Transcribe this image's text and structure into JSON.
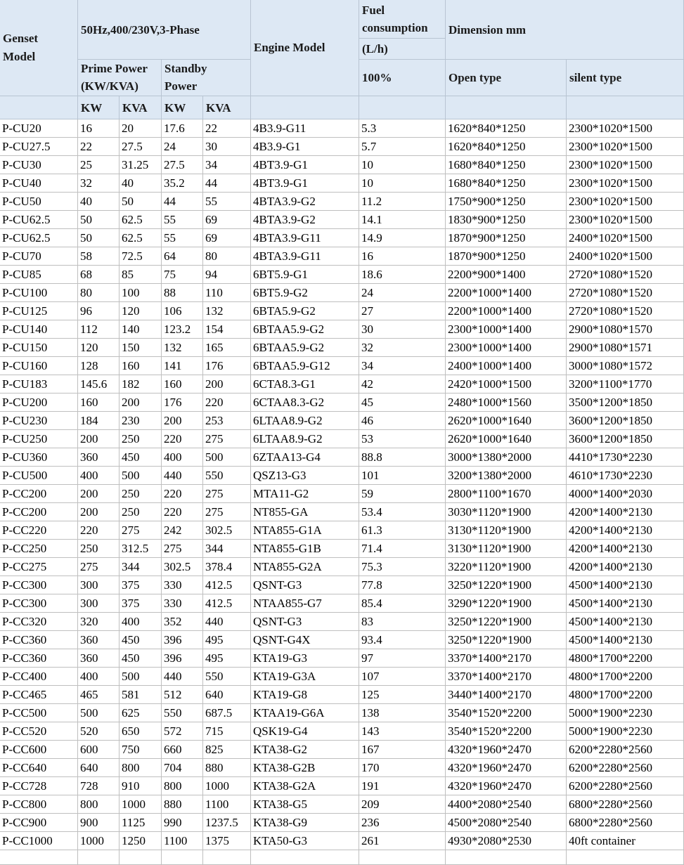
{
  "header": {
    "genset_model": "Genset\nModel",
    "power_spec": "50Hz,400/230V,3-Phase",
    "engine_model": "Engine Model",
    "fuel_consumption": "Fuel\nconsumption",
    "fuel_unit": "(L/h)",
    "dimension": "Dimension mm",
    "prime_power": "Prime Power\n(KW/KVA)",
    "standby_power": "Standby\nPower",
    "fuel_load": "100%",
    "open_type": "Open type",
    "silent_type": "silent type",
    "unit_kw_prime": "KW",
    "unit_kva_prime": "KVA",
    "unit_kw_standby": "KW",
    "unit_kva_standby": "KVA"
  },
  "rows": [
    [
      "P-CU20",
      "16",
      "20",
      "17.6",
      "22",
      "4B3.9-G11",
      "5.3",
      "1620*840*1250",
      "2300*1020*1500"
    ],
    [
      "P-CU27.5",
      "22",
      "27.5",
      "24",
      "30",
      "4B3.9-G1",
      "5.7",
      "1620*840*1250",
      "2300*1020*1500"
    ],
    [
      "P-CU30",
      "25",
      "31.25",
      "27.5",
      "34",
      "4BT3.9-G1",
      "10",
      "1680*840*1250",
      "2300*1020*1500"
    ],
    [
      "P-CU40",
      "32",
      "40",
      "35.2",
      "44",
      "4BT3.9-G1",
      "10",
      "1680*840*1250",
      "2300*1020*1500"
    ],
    [
      "P-CU50",
      "40",
      "50",
      "44",
      "55",
      "4BTA3.9-G2",
      "11.2",
      "1750*900*1250",
      "2300*1020*1500"
    ],
    [
      "P-CU62.5",
      "50",
      "62.5",
      "55",
      "69",
      "4BTA3.9-G2",
      "14.1",
      "1830*900*1250",
      "2300*1020*1500"
    ],
    [
      "P-CU62.5",
      "50",
      "62.5",
      "55",
      "69",
      "4BTA3.9-G11",
      "14.9",
      "1870*900*1250",
      "2400*1020*1500"
    ],
    [
      "P-CU70",
      "58",
      "72.5",
      "64",
      "80",
      "4BTA3.9-G11",
      "16",
      "1870*900*1250",
      "2400*1020*1500"
    ],
    [
      "P-CU85",
      "68",
      "85",
      "75",
      "94",
      "6BT5.9-G1",
      "18.6",
      "2200*900*1400",
      "2720*1080*1520"
    ],
    [
      "P-CU100",
      "80",
      "100",
      "88",
      "110",
      "6BT5.9-G2",
      "24",
      "2200*1000*1400",
      "2720*1080*1520"
    ],
    [
      "P-CU125",
      "96",
      "120",
      "106",
      "132",
      "6BTA5.9-G2",
      "27",
      "2200*1000*1400",
      "2720*1080*1520"
    ],
    [
      "P-CU140",
      "112",
      "140",
      "123.2",
      "154",
      "6BTAA5.9-G2",
      "30",
      "2300*1000*1400",
      "2900*1080*1570"
    ],
    [
      "P-CU150",
      "120",
      "150",
      "132",
      "165",
      "6BTAA5.9-G2",
      "32",
      "2300*1000*1400",
      "2900*1080*1571"
    ],
    [
      "P-CU160",
      "128",
      "160",
      "141",
      "176",
      "6BTAA5.9-G12",
      "34",
      "2400*1000*1400",
      "3000*1080*1572"
    ],
    [
      "P-CU183",
      "145.6",
      "182",
      "160",
      "200",
      "6CTA8.3-G1",
      "42",
      "2420*1000*1500",
      "3200*1100*1770"
    ],
    [
      "P-CU200",
      "160",
      "200",
      "176",
      "220",
      "6CTAA8.3-G2",
      "45",
      "2480*1000*1560",
      "3500*1200*1850"
    ],
    [
      "P-CU230",
      "184",
      "230",
      "200",
      "253",
      "6LTAA8.9-G2",
      "46",
      "2620*1000*1640",
      "3600*1200*1850"
    ],
    [
      "P-CU250",
      "200",
      "250",
      "220",
      "275",
      "6LTAA8.9-G2",
      "53",
      "2620*1000*1640",
      "3600*1200*1850"
    ],
    [
      "P-CU360",
      "360",
      "450",
      "400",
      "500",
      "6ZTAA13-G4",
      "88.8",
      "3000*1380*2000",
      "4410*1730*2230"
    ],
    [
      "P-CU500",
      "400",
      "500",
      "440",
      "550",
      "QSZ13-G3",
      "101",
      "3200*1380*2000",
      "4610*1730*2230"
    ],
    [
      "P-CC200",
      "200",
      "250",
      "220",
      "275",
      "MTA11-G2",
      "59",
      "2800*1100*1670",
      "4000*1400*2030"
    ],
    [
      "P-CC200",
      "200",
      "250",
      "220",
      "275",
      "NT855-GA",
      "53.4",
      "3030*1120*1900",
      "4200*1400*2130"
    ],
    [
      "P-CC220",
      "220",
      "275",
      "242",
      "302.5",
      "NTA855-G1A",
      "61.3",
      "3130*1120*1900",
      "4200*1400*2130"
    ],
    [
      "P-CC250",
      "250",
      "312.5",
      "275",
      "344",
      "NTA855-G1B",
      "71.4",
      "3130*1120*1900",
      "4200*1400*2130"
    ],
    [
      "P-CC275",
      "275",
      "344",
      "302.5",
      "378.4",
      "NTA855-G2A",
      "75.3",
      "3220*1120*1900",
      "4200*1400*2130"
    ],
    [
      "P-CC300",
      "300",
      "375",
      "330",
      "412.5",
      "QSNT-G3",
      "77.8",
      "3250*1220*1900",
      "4500*1400*2130"
    ],
    [
      "P-CC300",
      "300",
      "375",
      "330",
      "412.5",
      "NTAA855-G7",
      "85.4",
      "3290*1220*1900",
      "4500*1400*2130"
    ],
    [
      "P-CC320",
      "320",
      "400",
      "352",
      "440",
      "QSNT-G3",
      "83",
      "3250*1220*1900",
      "4500*1400*2130"
    ],
    [
      "P-CC360",
      "360",
      "450",
      "396",
      "495",
      "QSNT-G4X",
      "93.4",
      "3250*1220*1900",
      "4500*1400*2130"
    ],
    [
      "P-CC360",
      "360",
      "450",
      "396",
      "495",
      "KTA19-G3",
      "97",
      "3370*1400*2170",
      "4800*1700*2200"
    ],
    [
      "P-CC400",
      "400",
      "500",
      "440",
      "550",
      "KTA19-G3A",
      "107",
      "3370*1400*2170",
      "4800*1700*2200"
    ],
    [
      "P-CC465",
      "465",
      "581",
      "512",
      "640",
      "KTA19-G8",
      "125",
      "3440*1400*2170",
      "4800*1700*2200"
    ],
    [
      "P-CC500",
      "500",
      "625",
      "550",
      "687.5",
      "KTAA19-G6A",
      "138",
      "3540*1520*2200",
      "5000*1900*2230"
    ],
    [
      "P-CC520",
      "520",
      "650",
      "572",
      "715",
      "QSK19-G4",
      "143",
      "3540*1520*2200",
      "5000*1900*2230"
    ],
    [
      "P-CC600",
      "600",
      "750",
      "660",
      "825",
      "KTA38-G2",
      "167",
      "4320*1960*2470",
      "6200*2280*2560"
    ],
    [
      "P-CC640",
      "640",
      "800",
      "704",
      "880",
      "KTA38-G2B",
      "170",
      "4320*1960*2470",
      "6200*2280*2560"
    ],
    [
      "P-CC728",
      "728",
      "910",
      "800",
      "1000",
      "KTA38-G2A",
      "191",
      "4320*1960*2470",
      "6200*2280*2560"
    ],
    [
      "P-CC800",
      "800",
      "1000",
      "880",
      "1100",
      "KTA38-G5",
      "209",
      "4400*2080*2540",
      "6800*2280*2560"
    ],
    [
      "P-CC900",
      "900",
      "1125",
      "990",
      "1237.5",
      "KTA38-G9",
      "236",
      "4500*2080*2540",
      "6800*2280*2560"
    ],
    [
      "P-CC1000",
      "1000",
      "1250",
      "1100",
      "1375",
      "KTA50-G3",
      "261",
      "4930*2080*2530",
      "40ft container"
    ]
  ]
}
